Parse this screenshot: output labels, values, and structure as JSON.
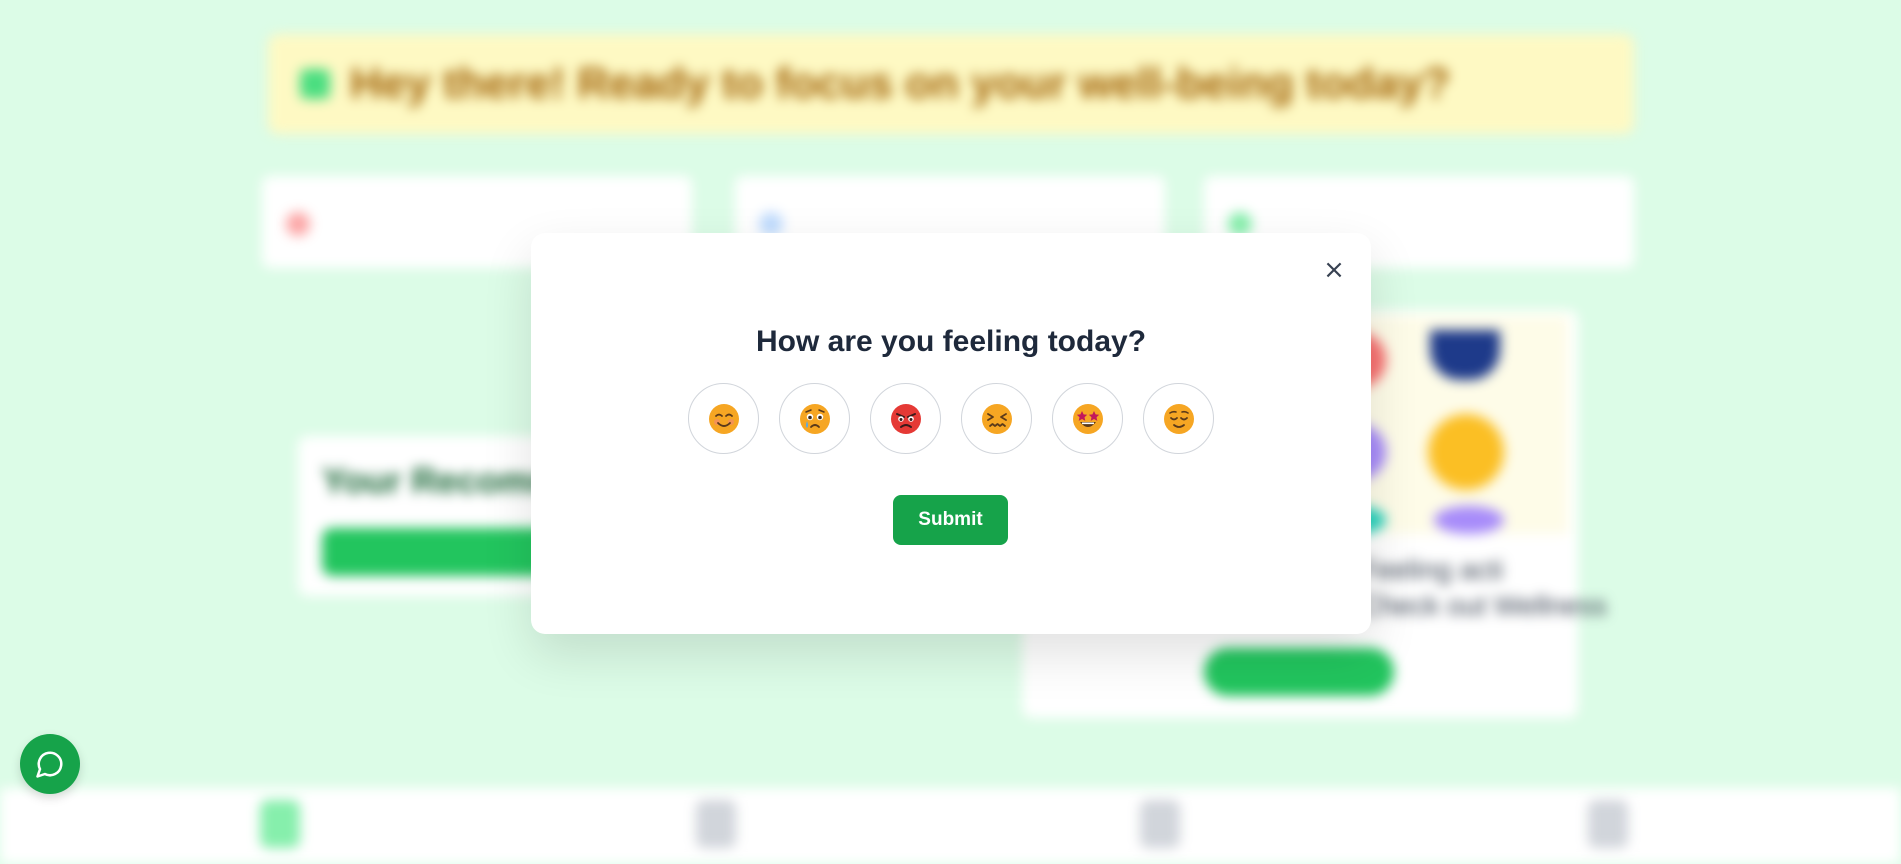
{
  "background": {
    "banner_text": "Hey there! Ready to focus on your well-being today?",
    "reco_title": "Your Recomm",
    "right_card_text_1": "Feeling acti",
    "right_card_text_2": "Check out Wellness"
  },
  "modal": {
    "title": "How are you feeling today?",
    "close_label": "×",
    "moods": [
      {
        "name": "happy",
        "icon": "smiling-face-icon"
      },
      {
        "name": "sad",
        "icon": "crying-face-icon"
      },
      {
        "name": "angry",
        "icon": "angry-face-icon"
      },
      {
        "name": "stressed",
        "icon": "confounded-face-icon"
      },
      {
        "name": "excited",
        "icon": "star-struck-face-icon"
      },
      {
        "name": "calm",
        "icon": "relieved-face-icon"
      }
    ],
    "submit_label": "Submit"
  },
  "colors": {
    "page_bg": "#dcfce7",
    "accent": "#16a34a",
    "banner_bg": "#fef9c3"
  },
  "chat": {
    "icon": "chat-bubble-icon"
  }
}
